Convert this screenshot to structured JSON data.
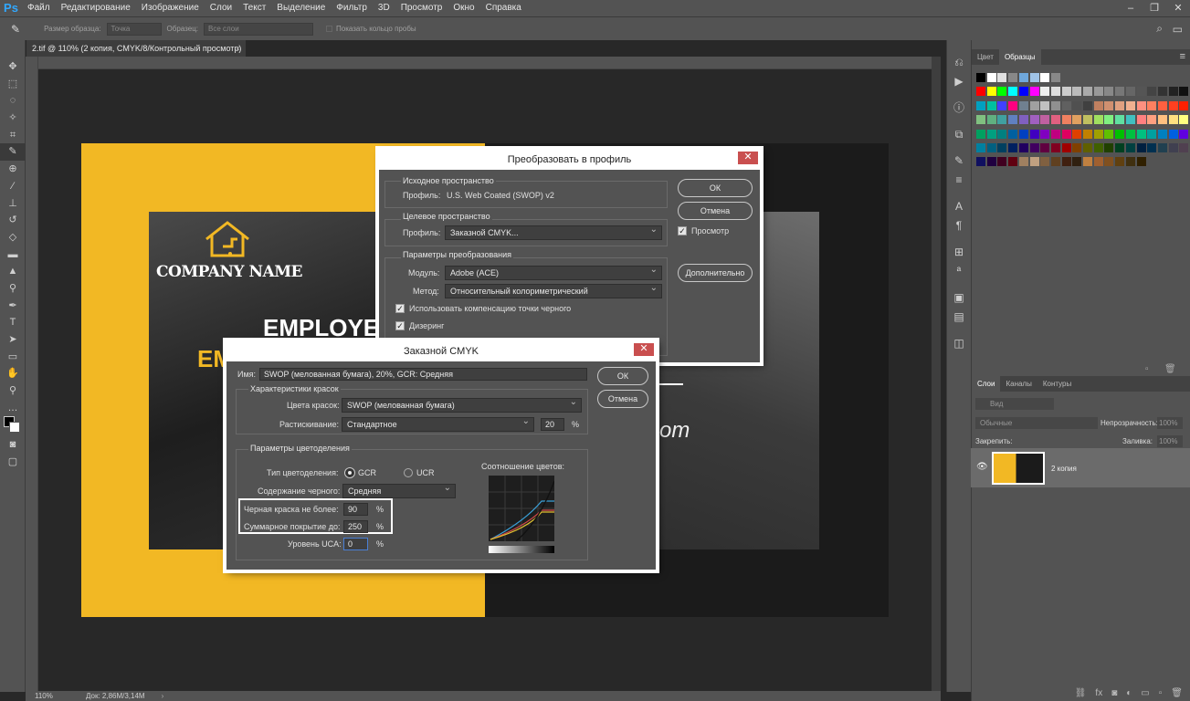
{
  "app": {
    "logo": "Ps",
    "menu": [
      "Файл",
      "Редактирование",
      "Изображение",
      "Слои",
      "Текст",
      "Выделение",
      "Фильтр",
      "3D",
      "Просмотр",
      "Окно",
      "Справка"
    ]
  },
  "options": {
    "sample_size_label": "Размер образца:",
    "sample_size_value": "Точка",
    "sample_label": "Образец:",
    "sample_value": "Все слои",
    "ring_label": "Показать кольцо пробы"
  },
  "document": {
    "tab_title": "2.tif @ 110% (2 копия, CMYK/8/Контрольный просмотр) *",
    "zoom": "110%",
    "doc_info": "Док: 2,86M/3,14M"
  },
  "artwork": {
    "company": "COMPANY NAME",
    "employee": "EMPLOYE",
    "em": "EM",
    "com": "om"
  },
  "profile_dialog": {
    "title": "Преобразовать в профиль",
    "source_group": "Исходное пространство",
    "source_profile_label": "Профиль:",
    "source_profile_value": "U.S. Web Coated (SWOP) v2",
    "target_group": "Целевое пространство",
    "target_profile_label": "Профиль:",
    "target_profile_value": "Заказной CMYK...",
    "conv_group": "Параметры преобразования",
    "module_label": "Модуль:",
    "module_value": "Adobe (ACE)",
    "method_label": "Метод:",
    "method_value": "Относительный колориметрический",
    "bpc_label": "Использовать компенсацию точки черного",
    "dither_label": "Дизеринг",
    "ok": "ОК",
    "cancel": "Отмена",
    "preview": "Просмотр",
    "advanced": "Дополнительно"
  },
  "cmyk_dialog": {
    "title": "Заказной CMYK",
    "name_label": "Имя:",
    "name_value": "SWOP (мелованная бумага), 20%, GCR: Средняя",
    "ink_group": "Характеристики красок",
    "ink_colors_label": "Цвета красок:",
    "ink_colors_value": "SWOP (мелованная бумага)",
    "dot_gain_label": "Растискивание:",
    "dot_gain_value": "Стандартное",
    "dot_gain_pct": "20",
    "pct": "%",
    "sep_group": "Параметры цветоделения",
    "sep_type_label": "Тип цветоделения:",
    "gcr": "GCR",
    "ucr": "UCR",
    "black_gen_label": "Содержание черного:",
    "black_gen_value": "Средняя",
    "black_limit_label": "Черная краска не более:",
    "black_limit_value": "90",
    "total_ink_label": "Суммарное покрытие до:",
    "total_ink_value": "250",
    "uca_label": "Уровень UCA:",
    "uca_value": "0",
    "graph_label": "Соотношение цветов:",
    "ok": "ОК",
    "cancel": "Отмена"
  },
  "right_panel": {
    "swatch_tabs": [
      "Цвет",
      "Образцы"
    ],
    "layer_tabs": [
      "Слои",
      "Каналы",
      "Контуры"
    ],
    "kind": "Вид",
    "blend": "Обычные",
    "opacity_label": "Непрозрачность:",
    "opacity_value": "100%",
    "lock_label": "Закрепить:",
    "fill_label": "Заливка:",
    "fill_value": "100%",
    "layer_name": "2 копия"
  }
}
